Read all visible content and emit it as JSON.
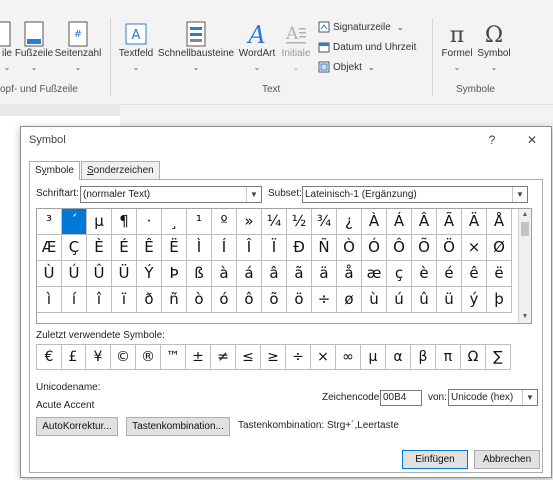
{
  "ribbon": {
    "buttons": [
      {
        "label": "ile",
        "icon": "header-icon"
      },
      {
        "label": "Fußzeile",
        "icon": "footer-icon"
      },
      {
        "label": "Seitenzahl",
        "icon": "page-number-icon"
      },
      {
        "label": "Textfeld",
        "icon": "textbox-icon"
      },
      {
        "label": "Schnellbausteine",
        "icon": "quick-parts-icon"
      },
      {
        "label": "WordArt",
        "icon": "wordart-icon"
      },
      {
        "label": "Initiale",
        "icon": "drop-cap-icon"
      },
      {
        "label": "Formel",
        "icon": "pi-icon"
      },
      {
        "label": "Symbol",
        "icon": "omega-icon"
      }
    ],
    "small_items": [
      "Signaturzeile",
      "Datum und Uhrzeit",
      "Objekt"
    ],
    "group_labels": [
      "opf- und Fußzeile",
      "Text",
      "Symbole"
    ]
  },
  "dialog": {
    "title": "Symbol",
    "tabs": [
      {
        "label_prefix": "S",
        "label_underline": "y",
        "label_rest": "mbole"
      },
      {
        "label_prefix": "",
        "label_underline": "S",
        "label_rest": "onderzeichen"
      }
    ],
    "font_label": "Schriftart:",
    "font_value": "(normaler Text)",
    "subset_label": "Subset:",
    "subset_value": "Lateinisch-1 (Ergänzung)",
    "grid_rows": [
      [
        "³",
        "´",
        "µ",
        "¶",
        "·",
        "¸",
        "¹",
        "º",
        "»",
        "¼",
        "½",
        "¾",
        "¿",
        "À",
        "Á",
        "Â",
        "Ã",
        "Ä",
        "Å"
      ],
      [
        "Æ",
        "Ç",
        "È",
        "É",
        "Ê",
        "Ë",
        "Ì",
        "Í",
        "Î",
        "Ï",
        "Ð",
        "Ñ",
        "Ò",
        "Ó",
        "Ô",
        "Õ",
        "Ö",
        "×",
        "Ø"
      ],
      [
        "Ù",
        "Ú",
        "Û",
        "Ü",
        "Ý",
        "Þ",
        "ß",
        "à",
        "á",
        "â",
        "ã",
        "ä",
        "å",
        "æ",
        "ç",
        "è",
        "é",
        "ê",
        "ë"
      ],
      [
        "ì",
        "í",
        "î",
        "ï",
        "ð",
        "ñ",
        "ò",
        "ó",
        "ô",
        "õ",
        "ö",
        "÷",
        "ø",
        "ù",
        "ú",
        "û",
        "ü",
        "ý",
        "þ"
      ]
    ],
    "selected_symbol": "´",
    "recent_label": "Zuletzt verwendete Symbole:",
    "recent_symbols": [
      "€",
      "£",
      "¥",
      "©",
      "®",
      "™",
      "±",
      "≠",
      "≤",
      "≥",
      "÷",
      "×",
      "∞",
      "µ",
      "α",
      "β",
      "π",
      "Ω",
      "∑"
    ],
    "unicode_name_label": "Unicodename:",
    "unicode_name_value": "Acute Accent",
    "charcode_label": "Zeichencode:",
    "charcode_value": "00B4",
    "from_label": "von:",
    "from_value": "Unicode (hex)",
    "autocorrect_button": "AutoKorrektur...",
    "shortcut_button": "Tastenkombination...",
    "shortcut_text": "Tastenkombination: Strg+´,Leertaste",
    "insert_button": "Einfügen",
    "cancel_button": "Abbrechen"
  }
}
